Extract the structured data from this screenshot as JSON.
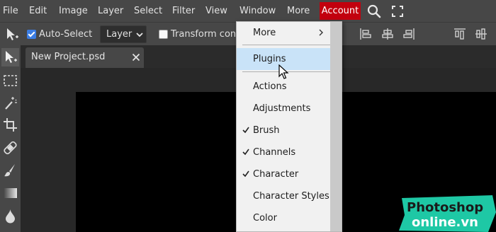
{
  "menubar": {
    "items": [
      "File",
      "Edit",
      "Image",
      "Layer",
      "Select",
      "Filter",
      "View",
      "Window",
      "More"
    ],
    "account_label": "Account",
    "account_color": "#c2000e",
    "search_icon": "search-icon",
    "fullscreen_icon": "fullscreen-icon"
  },
  "options": {
    "auto_select_label": "Auto-Select",
    "auto_select_checked": true,
    "layer_select_value": "Layer",
    "transform_label": "Transform cont",
    "transform_checked": false
  },
  "tabs": [
    {
      "label": "New Project.psd"
    }
  ],
  "window_menu": {
    "items": [
      {
        "label": "More",
        "submenu": true,
        "checked": false,
        "highlighted": false
      },
      {
        "label": "Plugins",
        "submenu": false,
        "checked": false,
        "highlighted": true
      },
      {
        "label": "Actions",
        "submenu": false,
        "checked": false,
        "highlighted": false
      },
      {
        "label": "Adjustments",
        "submenu": false,
        "checked": false,
        "highlighted": false
      },
      {
        "label": "Brush",
        "submenu": false,
        "checked": true,
        "highlighted": false
      },
      {
        "label": "Channels",
        "submenu": false,
        "checked": true,
        "highlighted": false
      },
      {
        "label": "Character",
        "submenu": false,
        "checked": true,
        "highlighted": false
      },
      {
        "label": "Character Styles",
        "submenu": false,
        "checked": false,
        "highlighted": false
      },
      {
        "label": "Color",
        "submenu": false,
        "checked": false,
        "highlighted": false
      }
    ],
    "highlight_color": "#c9e3f8"
  },
  "watermark": {
    "line1": "Photoshop",
    "line2": "online.vn",
    "color": "#1ec8a5"
  }
}
